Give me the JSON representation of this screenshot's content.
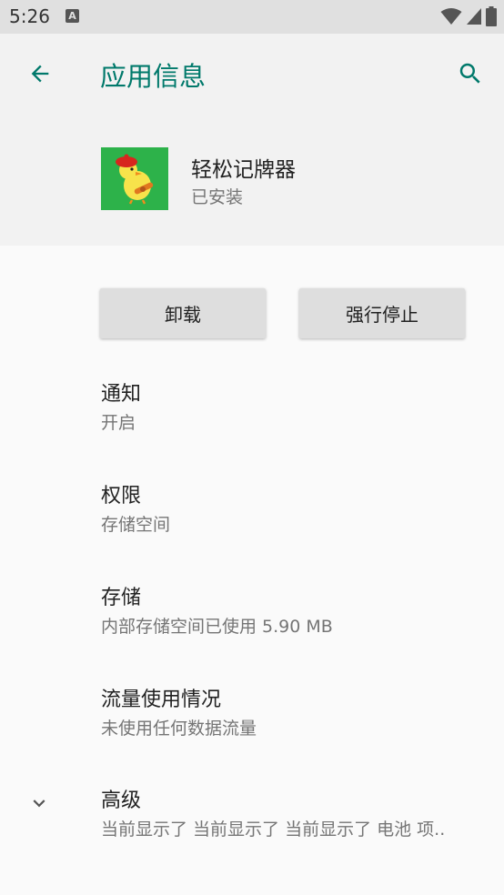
{
  "status_bar": {
    "time": "5:26",
    "notification_icon": "a-icon",
    "icons": [
      "wifi-icon",
      "signal-icon",
      "battery-icon"
    ]
  },
  "header": {
    "title": "应用信息",
    "back_icon": "arrow-back-icon",
    "search_icon": "search-icon"
  },
  "app": {
    "name": "轻松记牌器",
    "status": "已安装",
    "icon_bg": "#2db24a"
  },
  "buttons": {
    "uninstall": "卸载",
    "force_stop": "强行停止"
  },
  "settings": [
    {
      "title": "通知",
      "summary": "开启"
    },
    {
      "title": "权限",
      "summary": "存储空间"
    },
    {
      "title": "存储",
      "summary": "内部存储空间已使用 5.90 MB"
    },
    {
      "title": "流量使用情况",
      "summary": "未使用任何数据流量"
    },
    {
      "title": "高级",
      "summary": "当前显示了 当前显示了 当前显示了 电池 项..",
      "icon": "chevron-down-icon"
    }
  ],
  "colors": {
    "accent": "#00796b",
    "status_bar_bg": "#e0e0e0",
    "header_bg": "#f2f2f2",
    "page_bg": "#fafafa",
    "button_bg": "#dedede"
  }
}
